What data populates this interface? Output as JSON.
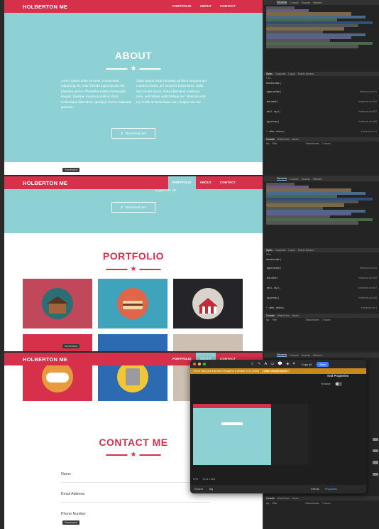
{
  "site": {
    "brand": "HOLBERTON ME",
    "nav": [
      "PORTFOLIO",
      "ABOUT",
      "CONTACT"
    ]
  },
  "about": {
    "title": "ABOUT",
    "para_left": "Lorem ipsum dolor sit amet, consectetur adipiscing elit. Nam blandit turpis iaculis nisi pharetra auctor. Phasellus mattis malesuada feugiat. Quisque maximus pretium risus scelerisque bibendum. Quisque viverra vulputate posuere.",
    "para_right": "Class aptent taciti sociosqu ad litora torquent per conubia nostra, per inceptos himenaeos. Nulla non ornare purus. Nulla bibendum maximus urna, sed finibus velit tristique vel. Vivamus ante mi, mollis at scelerisque non, feugiat non dui.",
    "download": "Download me!",
    "peek": "feugiat non dui."
  },
  "portfolio": {
    "title": "PORTFOLIO"
  },
  "contact": {
    "title": "CONTACT ME",
    "fields": [
      "Name",
      "Email Address",
      "Phone Number"
    ]
  },
  "tooltip": "Screenshot",
  "devtools": {
    "tabs": [
      "Elements",
      "Console",
      "Sources",
      "Network",
      "Performance"
    ],
    "styles_tabs": [
      "Styles",
      "Computed",
      "Layout",
      "Event Listeners",
      "DOM Breakpoints",
      "Properties",
      "Accessibility"
    ],
    "filter": "Filter",
    "rules": [
      {
        "sel": "element.style {",
        "src": ""
      },
      {
        "sel": ".page-section {",
        "src": "freelancer.css:61"
      },
      {
        "sel": ".text-white {",
        "src": "freelancer.css:362"
      },
      {
        "sel": ".mb-0, .my-0 {",
        "src": "freelancer.css:567"
      },
      {
        "sel": ".bg-primary {",
        "src": "freelancer.css:488"
      },
      {
        "sel": "*, ::after, ::before {",
        "src": "freelancer.css:1"
      }
    ],
    "console_tabs": [
      "Console",
      "What's New",
      "Issues"
    ],
    "context": "top",
    "levels": "Default levels",
    "issues": "7 Issues"
  },
  "tool": {
    "copy": "Copy all",
    "save": "Save",
    "banner": "You've used your free trial of Snagit for a decade or so. (2023)",
    "hide": "Hide / remove banner",
    "panel_title": "Tool Properties",
    "panel_opt": "Shadow",
    "bottom": [
      "Recent",
      "Tag"
    ],
    "zoom": "37%",
    "size": "1914 x 960",
    "effects": "Effects",
    "properties": "Properties"
  },
  "colors": {
    "nav": "#d7304a",
    "teal": "#8dd1d5",
    "accent": "#d7304a"
  }
}
